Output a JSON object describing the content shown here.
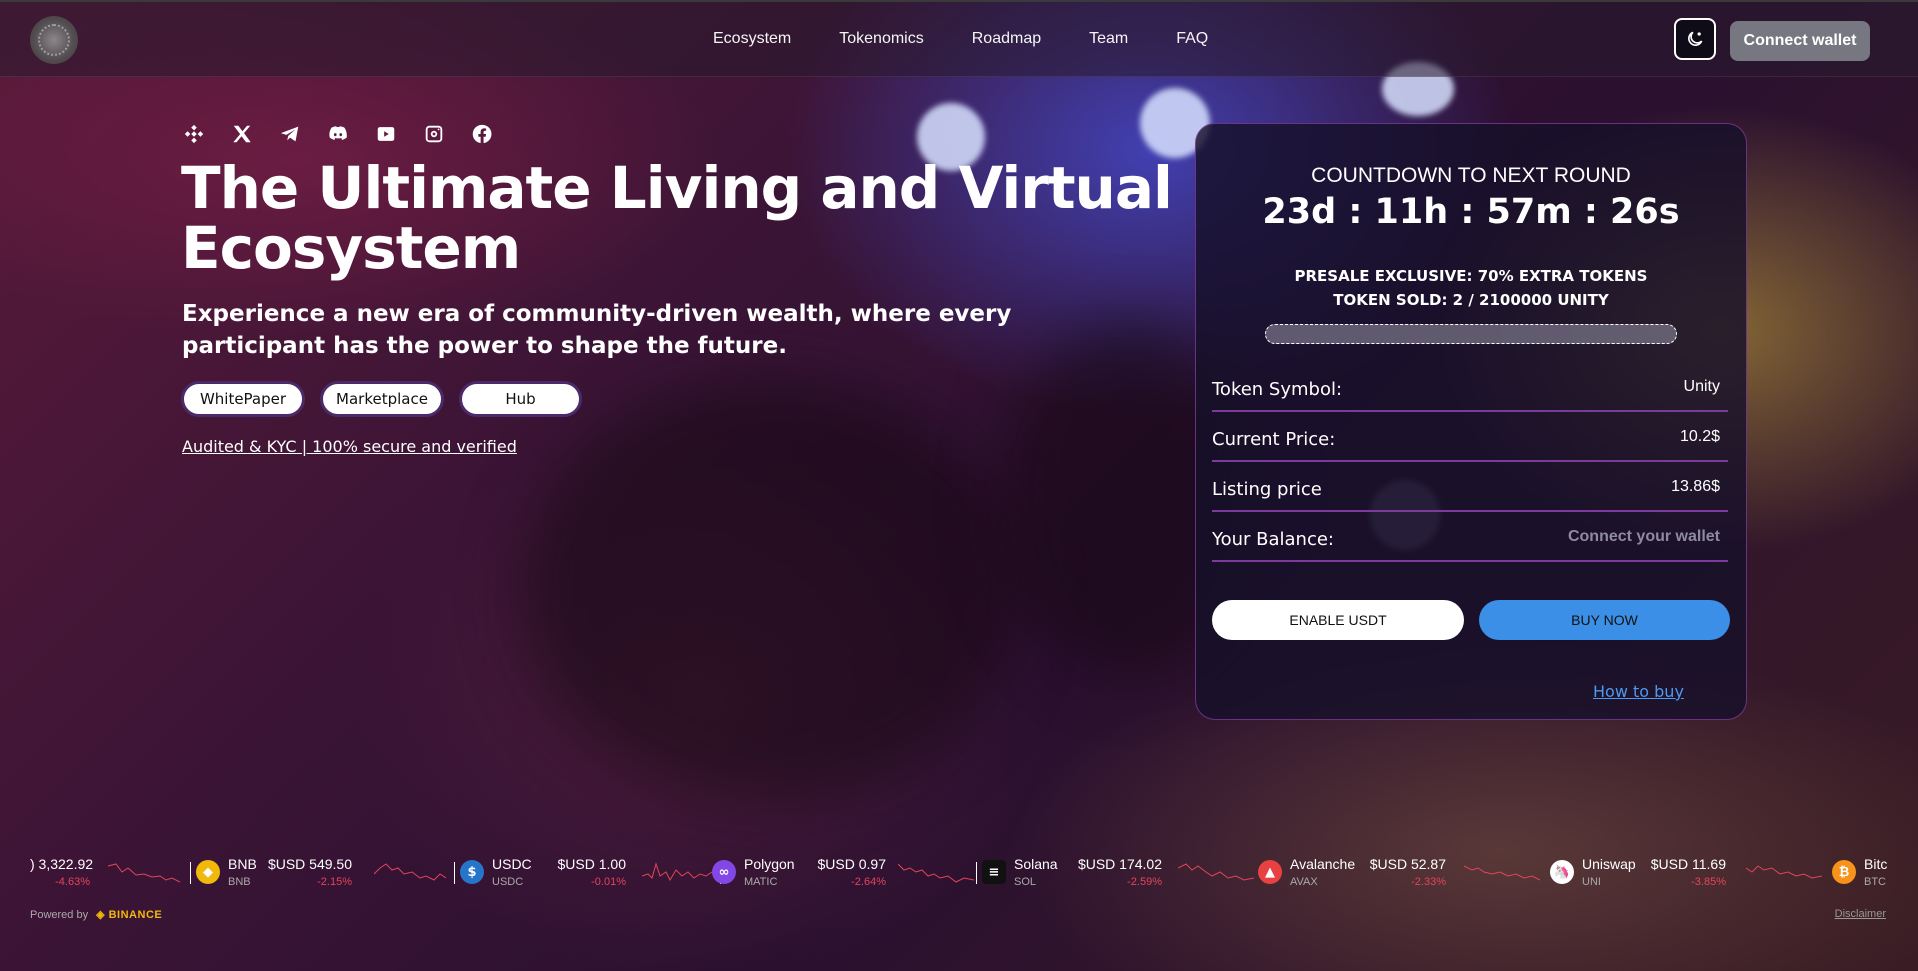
{
  "nav": {
    "items": [
      {
        "label": "Ecosystem"
      },
      {
        "label": "Tokenomics"
      },
      {
        "label": "Roadmap"
      },
      {
        "label": "Team"
      },
      {
        "label": "FAQ"
      }
    ],
    "connect_wallet": "Connect wallet",
    "theme_icon": "moon-star-icon"
  },
  "hero": {
    "title": "The Ultimate Living and Virtual Ecosystem",
    "subtitle": "Experience a new era of community-driven wealth, where every participant has the power to shape the future.",
    "buttons": [
      "WhitePaper",
      "Marketplace",
      "Hub"
    ],
    "audit_link": "Audited & KYC | 100% secure and verified",
    "socials": [
      "binance-icon",
      "x-icon",
      "telegram-icon",
      "discord-icon",
      "youtube-icon",
      "instagram-icon",
      "facebook-icon"
    ]
  },
  "presale": {
    "countdown_title": "COUNTDOWN TO NEXT ROUND",
    "countdown": "23d : 11h : 57m : 26s",
    "exclusive": "PRESALE EXCLUSIVE: 70% EXTRA TOKENS",
    "sold": "TOKEN SOLD: 2 / 2100000 UNITY",
    "progress_fraction": 1e-06,
    "rows": [
      {
        "label": "Token Symbol:",
        "value": "Unity"
      },
      {
        "label": "Current Price:",
        "value": "10.2$"
      },
      {
        "label": "Listing price",
        "value": "13.86$"
      },
      {
        "label": "Your Balance:",
        "value": "Connect your wallet"
      }
    ],
    "enable_button": "ENABLE USDT",
    "buy_button": "BUY NOW",
    "how_to_buy": "How to buy"
  },
  "ticker": {
    "items": [
      {
        "name": "",
        "symbol": "",
        "price": ") 3,322.92",
        "change": "-4.63%",
        "color": "#f7931a"
      },
      {
        "name": "BNB",
        "symbol": "BNB",
        "price": "$USD 549.50",
        "change": "-2.15%",
        "color": "#f0b90b"
      },
      {
        "name": "USDC",
        "symbol": "USDC",
        "price": "$USD 1.00",
        "change": "-0.01%",
        "color": "#2775ca"
      },
      {
        "name": "Polygon",
        "symbol": "MATIC",
        "price": "$USD 0.97",
        "change": "-2.64%",
        "color": "#8247e5"
      },
      {
        "name": "Solana",
        "symbol": "SOL",
        "price": "$USD 174.02",
        "change": "-2.59%",
        "color": "#111111"
      },
      {
        "name": "Avalanche",
        "symbol": "AVAX",
        "price": "$USD 52.87",
        "change": "-2.33%",
        "color": "#e84142"
      },
      {
        "name": "Uniswap",
        "symbol": "UNI",
        "price": "$USD 11.69",
        "change": "-3.85%",
        "color": "#ff007a"
      },
      {
        "name": "Bitc",
        "symbol": "BTC",
        "price": "",
        "change": "",
        "color": "#f7931a"
      }
    ],
    "powered_by": "Powered by",
    "binance": "BINANCE",
    "disclaimer": "Disclaimer"
  }
}
